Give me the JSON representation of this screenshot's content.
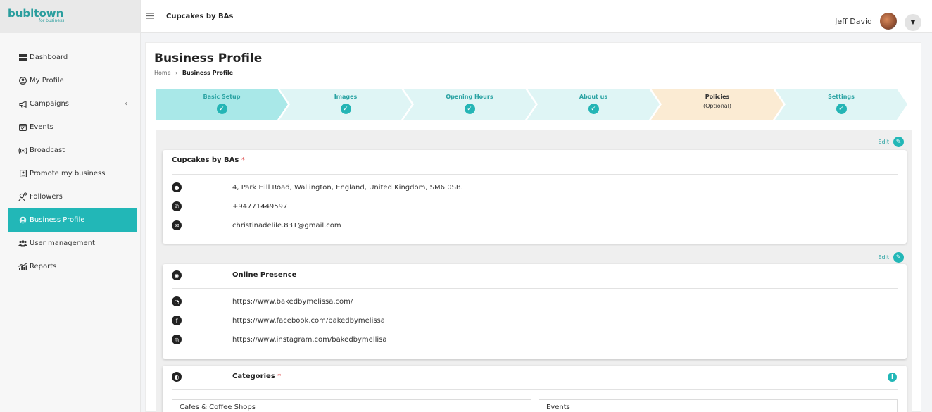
{
  "logo": {
    "main": "bubltown",
    "sub": "for business"
  },
  "sidebar": {
    "items": [
      {
        "label": "Dashboard",
        "icon": "grid-icon"
      },
      {
        "label": "My Profile",
        "icon": "user-circle-icon"
      },
      {
        "label": "Campaigns",
        "icon": "megaphone-icon",
        "chevron": "‹"
      },
      {
        "label": "Events",
        "icon": "calendar-icon"
      },
      {
        "label": "Broadcast",
        "icon": "broadcast-icon"
      },
      {
        "label": "Promote my business",
        "icon": "promote-icon"
      },
      {
        "label": "Followers",
        "icon": "followers-icon"
      },
      {
        "label": "Business Profile",
        "icon": "business-icon",
        "active": true
      },
      {
        "label": "User management",
        "icon": "users-icon"
      },
      {
        "label": "Reports",
        "icon": "chart-icon"
      }
    ]
  },
  "topbar": {
    "title": "Cupcakes by BAs",
    "user_name": "Jeff David"
  },
  "page": {
    "title": "Business Profile",
    "breadcrumb": {
      "home": "Home",
      "separator": "›",
      "current": "Business Profile"
    }
  },
  "steps": [
    {
      "label": "Basic Setup",
      "sub": "",
      "status": "complete",
      "color": "#a9e8e8"
    },
    {
      "label": "Images",
      "sub": "",
      "status": "complete",
      "color": "#dff5f5"
    },
    {
      "label": "Opening Hours",
      "sub": "",
      "status": "complete",
      "color": "#dff5f5"
    },
    {
      "label": "About us",
      "sub": "",
      "status": "complete",
      "color": "#dff5f5"
    },
    {
      "label": "Policies",
      "sub": "(Optional)",
      "status": "optional",
      "color": "#fbebd3"
    },
    {
      "label": "Settings",
      "sub": "",
      "status": "complete",
      "color": "#dff5f5"
    }
  ],
  "edit_label": "Edit",
  "basic_card": {
    "title": "Cupcakes by BAs",
    "required_mark": "*",
    "address": "4, Park Hill Road, Wallington, England, United Kingdom, SM6 0SB.",
    "phone": "+94771449597",
    "email": "christinadelile.831@gmail.com"
  },
  "online_card": {
    "title": "Online Presence",
    "website": "https://www.bakedbymelissa.com/",
    "facebook": "https://www.facebook.com/bakedbymelissa",
    "instagram": "https://www.instagram.com/bakedbymellisa"
  },
  "categories_card": {
    "title": "Categories",
    "required_mark": "*",
    "items": [
      "Cafes & Coffee Shops",
      "Events"
    ]
  },
  "colors": {
    "accent": "#22b7b7",
    "accent_text": "#2aa3a3",
    "required": "#e05555"
  }
}
